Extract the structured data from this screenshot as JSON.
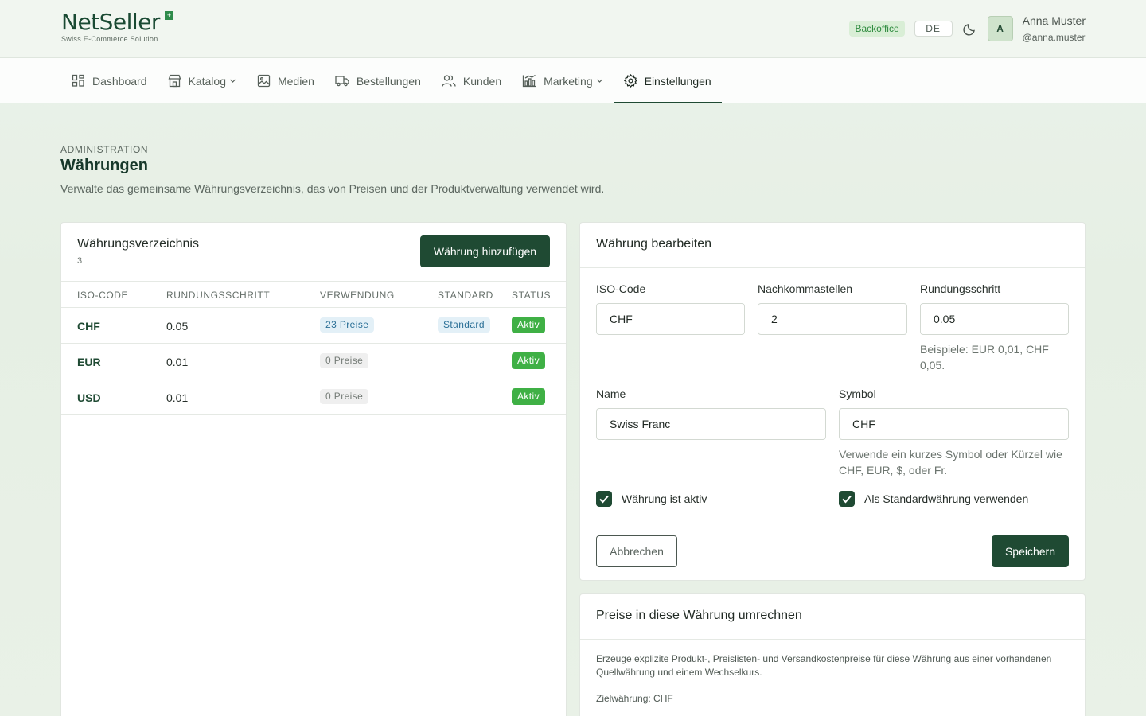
{
  "header": {
    "logo_text": "NetSeller",
    "logo_sub": "Swiss E-Commerce Solution",
    "logo_plus": "+",
    "badge": "Backoffice",
    "language": "DE",
    "avatar_initial": "A",
    "user_name": "Anna Muster",
    "user_handle": "@anna.muster"
  },
  "nav": {
    "items": [
      {
        "label": "Dashboard",
        "icon": "dashboard-icon"
      },
      {
        "label": "Katalog",
        "icon": "store-icon"
      },
      {
        "label": "Medien",
        "icon": "image-icon"
      },
      {
        "label": "Bestellungen",
        "icon": "truck-icon"
      },
      {
        "label": "Kunden",
        "icon": "users-icon"
      },
      {
        "label": "Marketing",
        "icon": "chart-icon"
      },
      {
        "label": "Einstellungen",
        "icon": "gear-icon"
      }
    ],
    "active": "Einstellungen"
  },
  "page": {
    "eyebrow": "ADMINISTRATION",
    "title": "Währungen",
    "description": "Verwalte das gemeinsame Währungsverzeichnis, das von Preisen und der Produktverwaltung verwendet wird."
  },
  "directory": {
    "title": "Währungsverzeichnis",
    "count": "3",
    "add_button": "Währung hinzufügen",
    "columns": [
      "ISO-CODE",
      "RUNDUNGSSCHRITT",
      "VERWENDUNG",
      "STANDARD",
      "STATUS"
    ],
    "rows": [
      {
        "code": "CHF",
        "rounding": "0.05",
        "usage": "23 Preise",
        "standard": "Standard",
        "status": "Aktiv"
      },
      {
        "code": "EUR",
        "rounding": "0.01",
        "usage": "0 Preise",
        "standard": "",
        "status": "Aktiv"
      },
      {
        "code": "USD",
        "rounding": "0.01",
        "usage": "0 Preise",
        "standard": "",
        "status": "Aktiv"
      }
    ]
  },
  "edit": {
    "title": "Währung bearbeiten",
    "iso_label": "ISO-Code",
    "iso_value": "CHF",
    "decimals_label": "Nachkommastellen",
    "decimals_value": "2",
    "rounding_label": "Rundungsschritt",
    "rounding_value": "0.05",
    "rounding_hint": "Beispiele: EUR 0,01, CHF 0,05.",
    "name_label": "Name",
    "name_value": "Swiss Franc",
    "symbol_label": "Symbol",
    "symbol_value": "CHF",
    "symbol_hint": "Verwende ein kurzes Symbol oder Kürzel wie CHF, EUR, $, oder Fr.",
    "active_label": "Währung ist aktiv",
    "active_checked": true,
    "default_label": "Als Standardwährung verwenden",
    "default_checked": true,
    "cancel": "Abbrechen",
    "save": "Speichern"
  },
  "convert": {
    "title": "Preise in diese Währung umrechnen",
    "text": "Erzeuge explizite Produkt-, Preislisten- und Versandkostenpreise für diese Währung aus einer vorhandenen Quellwährung und einem Wechselkurs.",
    "target": "Zielwährung: CHF"
  },
  "colors": {
    "brand": "#1f4a33",
    "active_green": "#3fb045",
    "info_blue": "#2a6f96"
  }
}
